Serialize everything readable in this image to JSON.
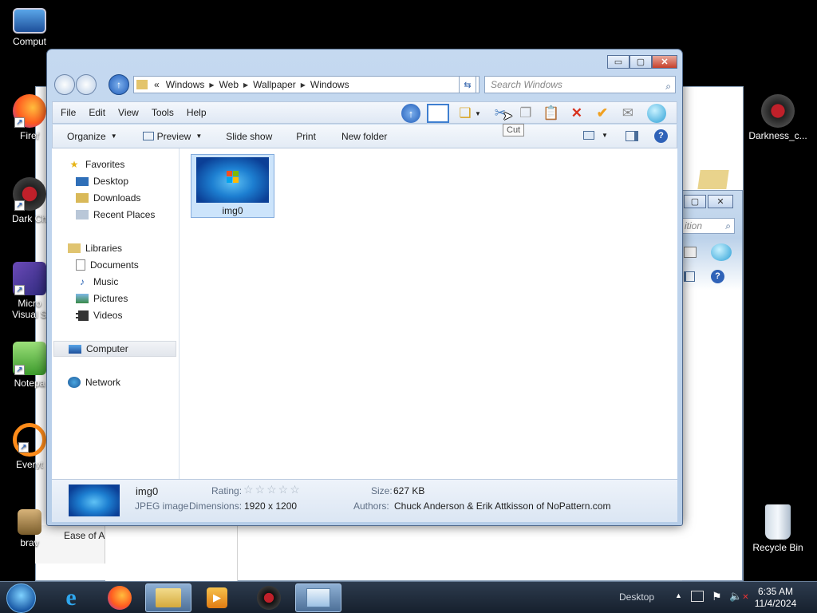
{
  "desktop": {
    "icons_left": [
      {
        "label": "Comput",
        "icon": "computer-icon"
      },
      {
        "label": "Firef",
        "icon": "firefox-icon"
      },
      {
        "label": "Dark Ch",
        "icon": "darkness-icon"
      },
      {
        "label": "Micro",
        "label2": "Visual S",
        "icon": "visual-studio-icon"
      },
      {
        "label": "Notepa",
        "icon": "notepad-icon"
      },
      {
        "label": "Everyt",
        "icon": "everything-icon"
      },
      {
        "label": "brav",
        "icon": "brave-icon"
      }
    ],
    "icons_right": [
      {
        "label": "Darkness_c...",
        "icon": "darkness-icon"
      },
      {
        "label": "Recycle Bin",
        "icon": "recycle-bin-icon"
      }
    ],
    "bg_window": {
      "search_placeholder": "ition",
      "strip_label": "Ease of Ac"
    }
  },
  "window": {
    "caption": {
      "minimize": "▭",
      "maximize": "▢",
      "close": "✕"
    },
    "address": {
      "prefix": "«",
      "segments": [
        "Windows",
        "Web",
        "Wallpaper",
        "Windows"
      ]
    },
    "search": {
      "placeholder": "Search Windows"
    },
    "menu": [
      "File",
      "Edit",
      "View",
      "Tools",
      "Help"
    ],
    "commands": {
      "organize": "Organize",
      "preview": "Preview",
      "slideshow": "Slide show",
      "print": "Print",
      "new_folder": "New folder"
    },
    "tooltip": "Cut",
    "nav": {
      "favorites": "Favorites",
      "desktop": "Desktop",
      "downloads": "Downloads",
      "recent": "Recent Places",
      "libraries": "Libraries",
      "documents": "Documents",
      "music": "Music",
      "pictures": "Pictures",
      "videos": "Videos",
      "computer": "Computer",
      "network": "Network"
    },
    "files": [
      {
        "name": "img0"
      }
    ],
    "details": {
      "name": "img0",
      "type": "JPEG image",
      "rating_label": "Rating:",
      "stars": "☆☆☆☆☆",
      "dimensions_label": "Dimensions:",
      "dimensions": "1920 x 1200",
      "size_label": "Size:",
      "size": "627 KB",
      "authors_label": "Authors:",
      "authors": "Chuck Anderson & Erik Attkisson of NoPattern.com"
    }
  },
  "taskbar": {
    "apps": [
      "internet-explorer-icon",
      "firefox-icon",
      "explorer-icon",
      "media-player-icon",
      "darkness-icon",
      "control-panel-icon"
    ],
    "desktop_label": "Desktop",
    "time": "6:35 AM",
    "date": "11/4/2024"
  }
}
